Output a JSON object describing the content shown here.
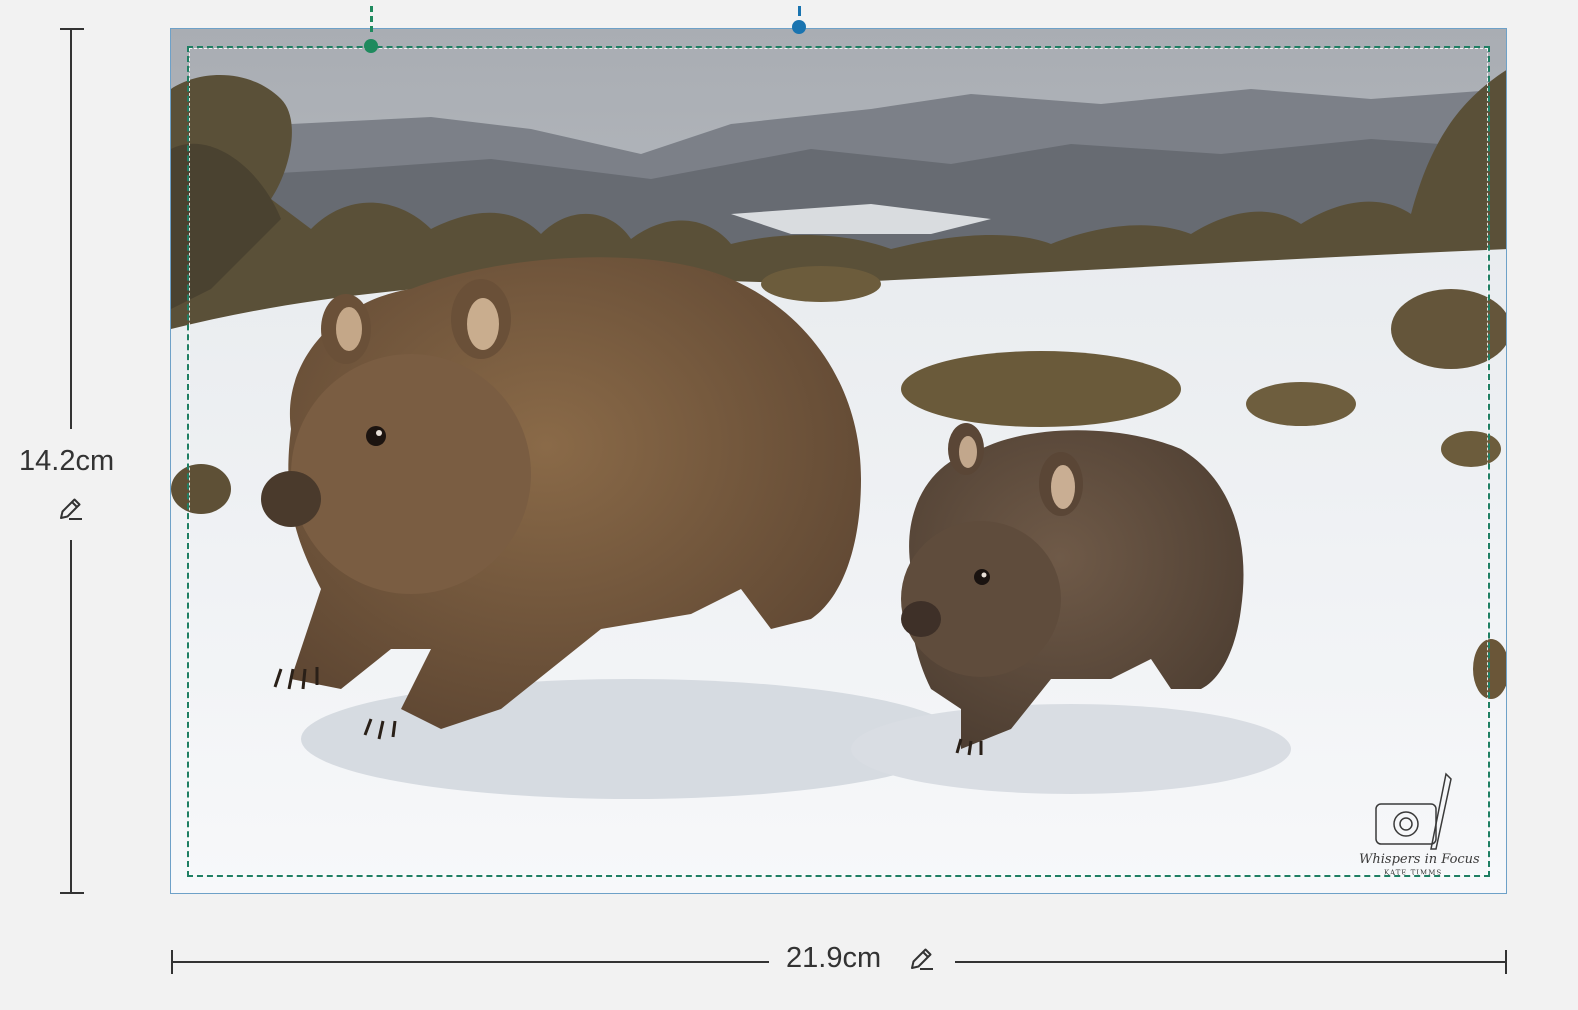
{
  "dimensions": {
    "height_label": "14.2cm",
    "width_label": "21.9cm"
  },
  "icons": {
    "edit": "pencil-icon",
    "handle": "crop-handle-icon"
  },
  "colors": {
    "frame_border": "#6ea1c8",
    "crop_guide": "#1f7f63",
    "handle_left": "#1f8a5e",
    "handle_right": "#1a74b0",
    "background": "#f2f2f2"
  },
  "photo": {
    "watermark_title": "Whispers in Focus",
    "watermark_subtitle": "KATE TIMMS"
  }
}
